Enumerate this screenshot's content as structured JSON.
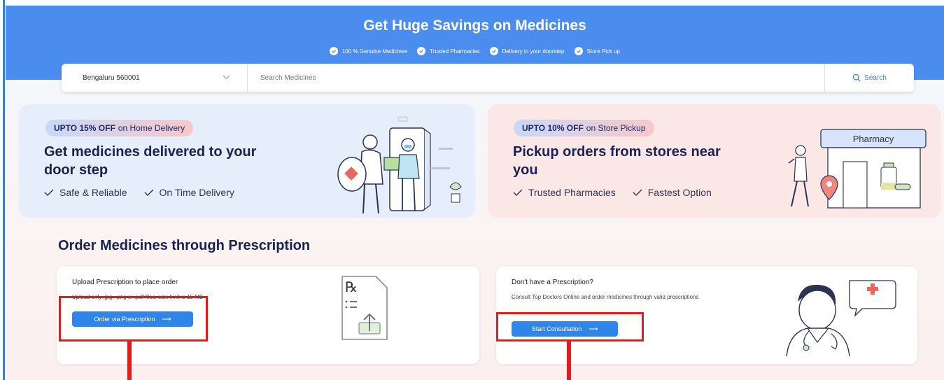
{
  "banner": {
    "title": "Get Huge Savings on Medicines",
    "features": [
      "100 % Genuine Medicines",
      "Trusted Pharmacies",
      "Delivery to your doorstep",
      "Store Pick up"
    ]
  },
  "search": {
    "location": "Bengaluru 560001",
    "placeholder": "Search Medicines",
    "button_label": "Search"
  },
  "offers": [
    {
      "tag_bold": "UPTO 15% OFF",
      "tag_rest": "on Home Delivery",
      "headline": "Get medicines delivered to your door step",
      "points": [
        "Safe & Reliable",
        "On Time Delivery"
      ]
    },
    {
      "tag_bold": "UPTO 10% OFF",
      "tag_rest": "on Store Pickup",
      "headline": "Pickup orders from stores near you",
      "points": [
        "Trusted Pharmacies",
        "Fastest Option"
      ],
      "illustration_sign": "Pharmacy"
    }
  ],
  "prescription": {
    "section_title": "Order Medicines through Prescription",
    "upload_card": {
      "title": "Upload Prescription to place order",
      "description": "Upload only .jpg, .png or .pdf files, size limit is 15 MB",
      "button_label": "Order via Prescription",
      "arrow": "⟶",
      "rx_symbol": "℞"
    },
    "consult_card": {
      "title": "Don't have a Prescription?",
      "description": "Consult Top Doctors Online and order medicines through valid prescriptions",
      "button_label": "Start Consultation",
      "arrow": "⟶"
    }
  },
  "colors": {
    "banner": "#4b8def",
    "cta": "#2f86ea",
    "callout_red": "#e41b1b",
    "heading_navy": "#1b2253"
  }
}
